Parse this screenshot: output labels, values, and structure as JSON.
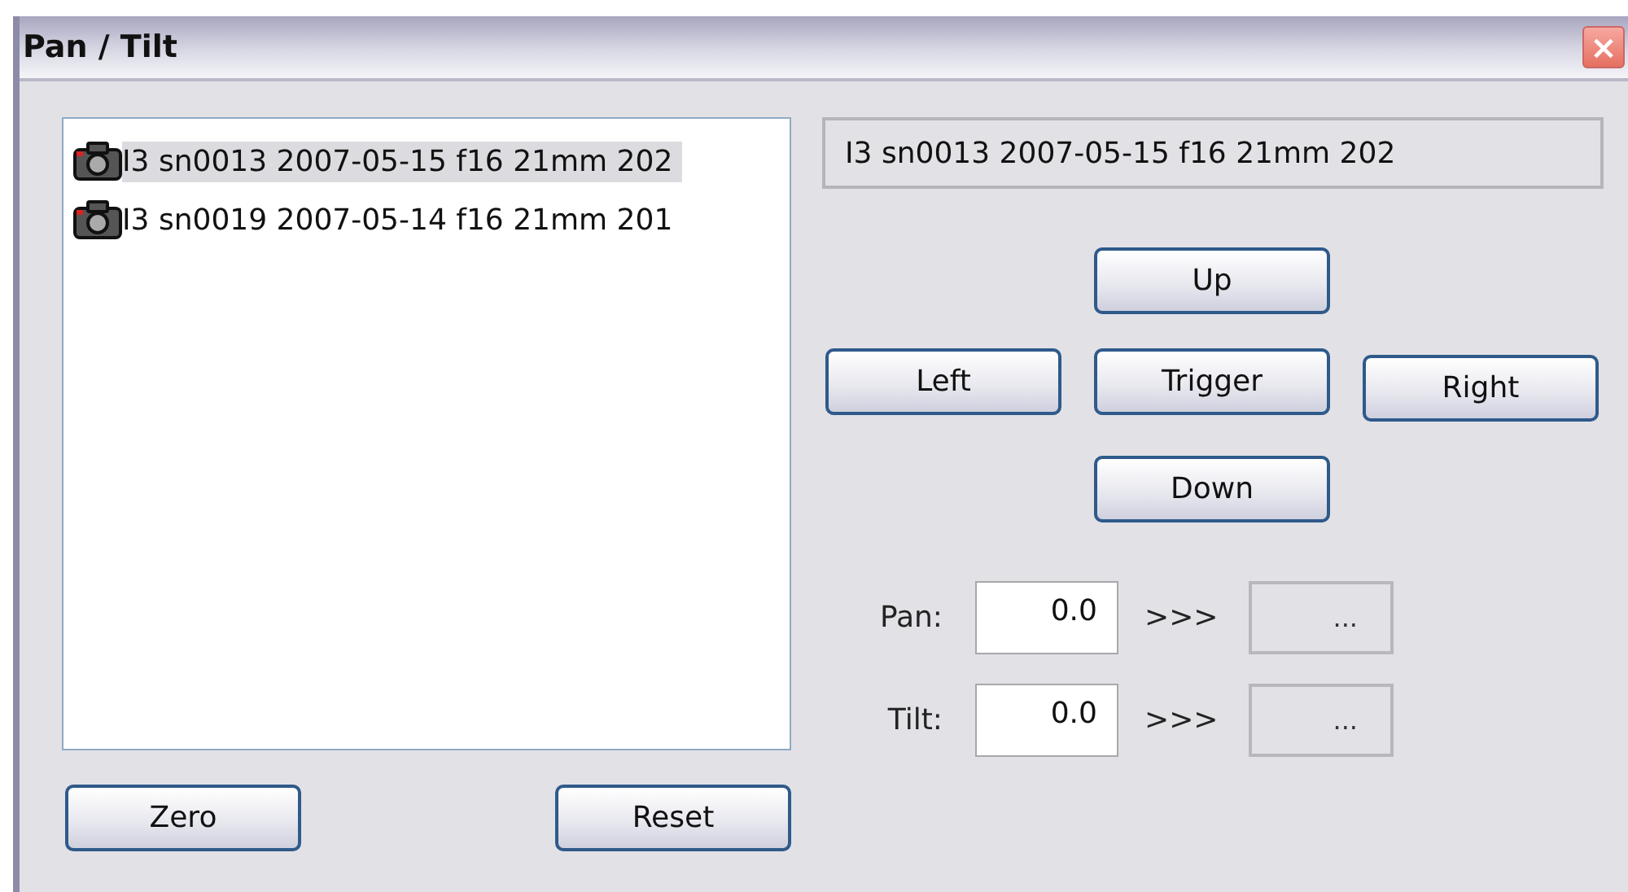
{
  "window": {
    "title": "Pan / Tilt",
    "close": "×"
  },
  "list": [
    {
      "label": "I3 sn0013 2007-05-15 f16 21mm 202",
      "selected": true
    },
    {
      "label": "I3 sn0019 2007-05-14 f16 21mm 201",
      "selected": false
    }
  ],
  "current": "I3 sn0013 2007-05-15 f16 21mm 202",
  "direction_buttons": {
    "up": "Up",
    "left": "Left",
    "trigger": "Trigger",
    "right": "Right",
    "down": "Down"
  },
  "axes": [
    {
      "label": "Pan:",
      "value": "0.0",
      "arrow": ">>>",
      "readout": "..."
    },
    {
      "label": "Tilt:",
      "value": "0.0",
      "arrow": ">>>",
      "readout": "..."
    }
  ],
  "bottom_buttons": [
    "Zero",
    "Reset"
  ]
}
